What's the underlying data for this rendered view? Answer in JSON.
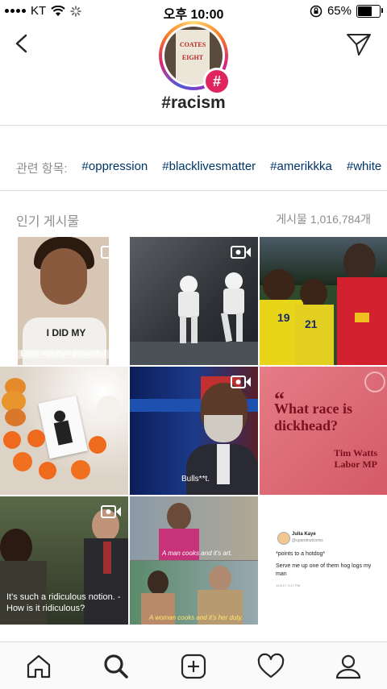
{
  "status_bar": {
    "carrier": "KT",
    "time": "오후 10:00",
    "battery": "65%",
    "battery_level": 0.65
  },
  "header": {
    "hashtag": "#racism",
    "badge_symbol": "#",
    "cover_text_1": "COATES",
    "cover_text_2": "EIGHT"
  },
  "related": {
    "label": "관련 항목:",
    "tags": [
      "#oppression",
      "#blacklivesmatter",
      "#amerikkka",
      "#white"
    ]
  },
  "section": {
    "title": "인기 게시물",
    "post_count": "게시물 1,016,784개"
  },
  "posts": [
    {
      "caption": "Love +unity= powerful",
      "shirt_text": "I DID MY",
      "video": true
    },
    {
      "caption": "",
      "video": true
    },
    {
      "caption": "",
      "jersey_1": "19",
      "jersey_2": "21",
      "video": false
    },
    {
      "caption": "",
      "video": false
    },
    {
      "caption": "Bulls**t.",
      "video": true
    },
    {
      "headline": "What race is dickhead?",
      "byline": "Tim Watts Labor MP",
      "video": false
    },
    {
      "caption": "It's such a ridiculous notion. - How is it ridiculous?",
      "video": true
    },
    {
      "caption_top": "A man cooks and it's art.",
      "caption_bottom": "A woman cooks and it's her duty.",
      "video": false
    },
    {
      "tweet_name": "Julia Kaye",
      "tweet_handle": "@upandoutcomic",
      "tweet_line1": "*points to a hotdog*",
      "tweet_line2": "Serve me up one of them hog logs my man",
      "tweet_time": "11/4/17, 5:17 PM",
      "video": false
    }
  ],
  "icons": {
    "back": "chevron-left-icon",
    "share": "paper-plane-icon",
    "tabs": [
      "home-icon",
      "search-icon",
      "add-icon",
      "heart-icon",
      "profile-icon"
    ]
  },
  "colors": {
    "link": "#003569",
    "muted": "#8e8e8e",
    "badge": "#e0245e"
  }
}
